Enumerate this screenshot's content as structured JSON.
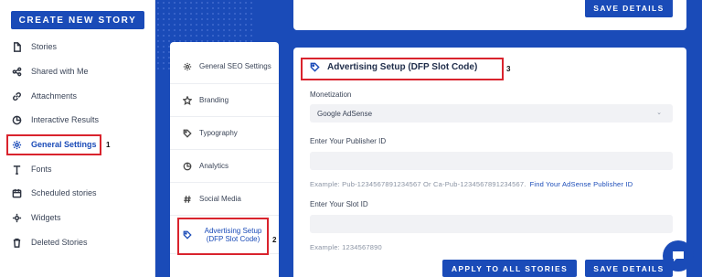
{
  "sidebar": {
    "create_label": "CREATE NEW STORY",
    "items": [
      {
        "label": "Stories",
        "icon": "file-icon"
      },
      {
        "label": "Shared with Me",
        "icon": "share-icon"
      },
      {
        "label": "Attachments",
        "icon": "link-icon"
      },
      {
        "label": "Interactive Results",
        "icon": "pie-chart-icon"
      },
      {
        "label": "General Settings",
        "icon": "gear-icon"
      },
      {
        "label": "Fonts",
        "icon": "font-icon"
      },
      {
        "label": "Scheduled stories",
        "icon": "calendar-icon"
      },
      {
        "label": "Widgets",
        "icon": "widget-icon"
      },
      {
        "label": "Deleted Stories",
        "icon": "trash-icon"
      }
    ]
  },
  "submenu": {
    "items": [
      {
        "label": "General SEO Settings",
        "icon": "gear-icon"
      },
      {
        "label": "Branding",
        "icon": "star-icon"
      },
      {
        "label": "Typography",
        "icon": "tag-icon"
      },
      {
        "label": "Analytics",
        "icon": "pie-chart-icon"
      },
      {
        "label": "Social Media",
        "icon": "hash-icon"
      },
      {
        "label": "Advertising Setup (DFP Slot Code)",
        "icon": "tag-icon"
      }
    ]
  },
  "top_card": {
    "save_label": "SAVE DETAILS"
  },
  "main": {
    "title": "Advertising Setup (DFP Slot Code)",
    "monetization_label": "Monetization",
    "monetization_value": "Google AdSense",
    "publisher_label": "Enter Your Publisher ID",
    "publisher_value": "",
    "publisher_hint": "Example: Pub-1234567891234567 Or Ca-Pub-1234567891234567.",
    "publisher_link": "Find Your AdSense Publisher ID",
    "slot_label": "Enter Your Slot ID",
    "slot_value": "",
    "slot_hint": "Example: 1234567890",
    "apply_label": "APPLY TO ALL STORIES",
    "save_label": "SAVE DETAILS"
  },
  "annotations": {
    "one": "1",
    "two": "2",
    "three": "3"
  },
  "colors": {
    "accent": "#1a4bb8",
    "highlight": "#d9232d"
  }
}
